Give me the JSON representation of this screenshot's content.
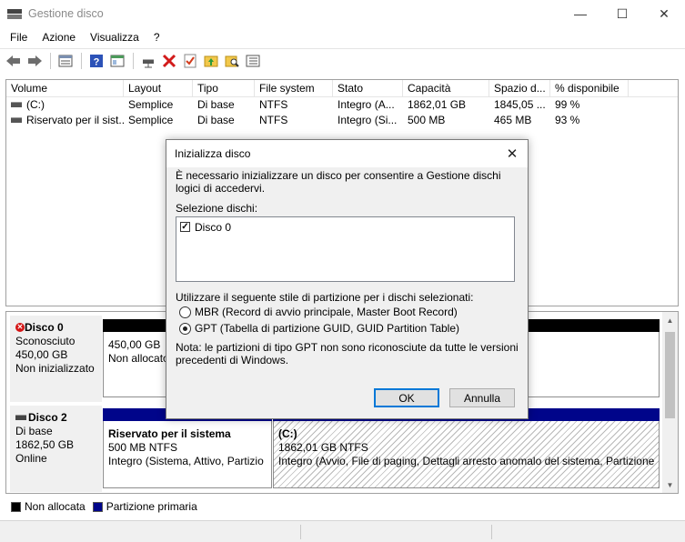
{
  "window": {
    "title": "Gestione disco",
    "controls": {
      "minimize": "—",
      "maximize": "☐",
      "close": "✕"
    }
  },
  "menu": [
    "File",
    "Azione",
    "Visualizza",
    "?"
  ],
  "toolbar": {
    "icons": [
      "back-arrow-icon",
      "forward-arrow-icon",
      "properties-grid-icon",
      "help-icon",
      "console-tree-icon",
      "connect-disk-icon",
      "delete-icon",
      "checklist-icon",
      "folder-up-icon",
      "search-folder-icon",
      "list-view-icon"
    ]
  },
  "volume_list": {
    "columns": [
      "Volume",
      "Layout",
      "Tipo",
      "File system",
      "Stato",
      "Capacità",
      "Spazio d...",
      "% disponibile",
      ""
    ],
    "rows": [
      {
        "volume": "(C:)",
        "layout": "Semplice",
        "tipo": "Di base",
        "fs": "NTFS",
        "stato": "Integro (A...",
        "capacita": "1862,01 GB",
        "spazio": "1845,05 ...",
        "perc": "99 %"
      },
      {
        "volume": "Riservato per il sist...",
        "layout": "Semplice",
        "tipo": "Di base",
        "fs": "NTFS",
        "stato": "Integro (Si...",
        "capacita": "500 MB",
        "spazio": "465 MB",
        "perc": "93 %"
      }
    ]
  },
  "disks": [
    {
      "name": "Disco 0",
      "type": "Sconosciuto",
      "size": "450,00 GB",
      "status": "Non inizializzato",
      "partitions": [
        {
          "size": "450,00 GB",
          "label": "Non allocato"
        }
      ]
    },
    {
      "name": "Disco 2",
      "type": "Di base",
      "size": "1862,50 GB",
      "status": "Online",
      "partitions": [
        {
          "name": "Riservato per il sistema",
          "size_fs": "500 MB NTFS",
          "status": "Integro (Sistema, Attivo, Partizio"
        },
        {
          "name": "(C:)",
          "size_fs": "1862,01 GB NTFS",
          "status": "Integro (Avvio, File di paging, Dettagli arresto anomalo del sistema, Partizione p"
        }
      ]
    }
  ],
  "legend": [
    {
      "label": "Non allocata",
      "color": "#000000"
    },
    {
      "label": "Partizione primaria",
      "color": "#00058a"
    }
  ],
  "dialog": {
    "title": "Inizializza disco",
    "message": "È necessario inizializzare un disco per consentire a Gestione dischi logici di accedervi.",
    "selection_label": "Selezione dischi:",
    "disk_item": "Disco 0",
    "disk_checked": true,
    "style_label": "Utilizzare il seguente stile di partizione per i dischi selezionati:",
    "options": [
      {
        "label": "MBR (Record di avvio principale, Master Boot Record)",
        "selected": false
      },
      {
        "label": "GPT (Tabella di partizione GUID, GUID Partition Table)",
        "selected": true
      }
    ],
    "note": "Nota: le partizioni di tipo GPT non sono riconosciute da tutte le versioni precedenti di Windows.",
    "ok_label": "OK",
    "cancel_label": "Annulla"
  }
}
